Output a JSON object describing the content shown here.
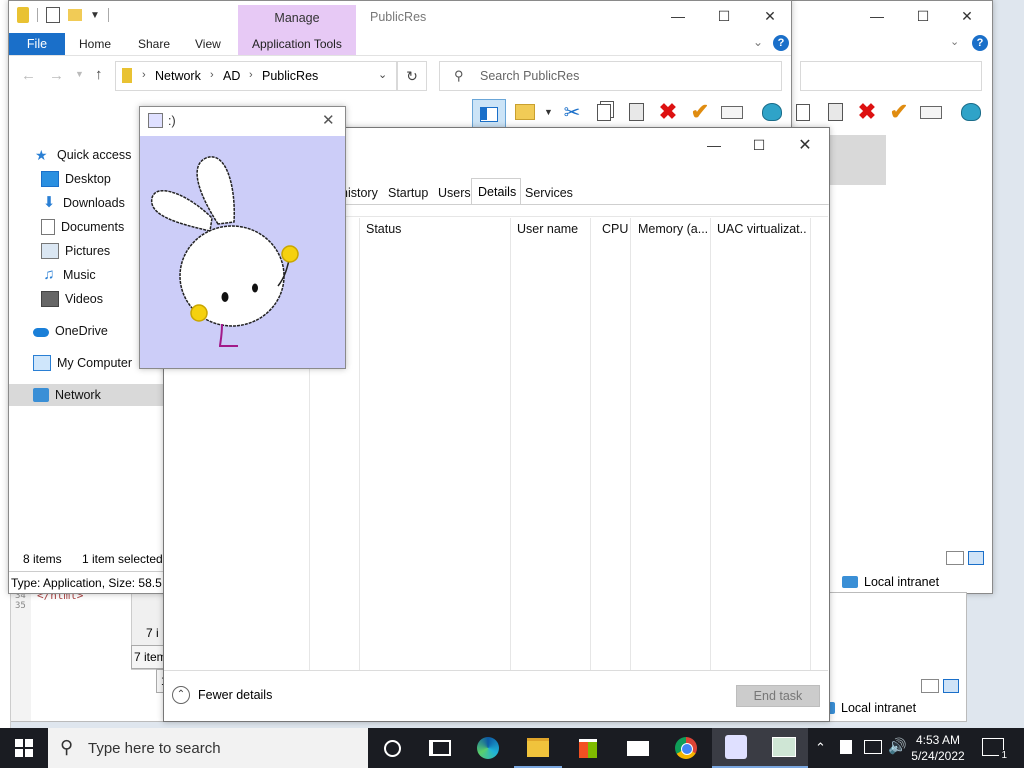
{
  "explorer_back": {
    "ribbon_tabs": [],
    "code_line_numbers": [
      "34",
      "35"
    ],
    "code_text": "</html>",
    "status_items_count": "7 items",
    "status_items_count_partial": "7 i",
    "status_partial": "1",
    "zone": "Local intranet",
    "zone2": "Local intranet"
  },
  "explorer": {
    "title": "PublicRes",
    "context_tab_group": "Manage",
    "ribbon_tabs": [
      "File",
      "Home",
      "Share",
      "View",
      "Application Tools"
    ],
    "breadcrumb": [
      "Network",
      "AD",
      "PublicRes"
    ],
    "search_placeholder": "Search PublicRes",
    "nav_items": [
      "Quick access",
      "Desktop",
      "Downloads",
      "Documents",
      "Pictures",
      "Music",
      "Videos",
      "OneDrive",
      "My Computer",
      "Network"
    ],
    "status_count": "8 items",
    "status_selected": "1 item selected",
    "details_bar": "Type: Application, Size: 58.5 M"
  },
  "bunny_window": {
    "title": ":)"
  },
  "task_manager": {
    "tabs": [
      "history",
      "Startup",
      "Users",
      "Details",
      "Services"
    ],
    "active_tab": "Details",
    "columns": [
      "Status",
      "User name",
      "CPU",
      "Memory (a...",
      "UAC virtualizat..."
    ],
    "fewer_details": "Fewer details",
    "end_task": "End task"
  },
  "taskbar": {
    "search_placeholder": "Type here to search",
    "time": "4:53 AM",
    "date": "5/24/2022",
    "notification_count": "1"
  },
  "colors": {
    "accent": "#1a6fc9",
    "manage_tab": "#e7c9f5",
    "bunny_bg": "#cccdf8",
    "taskbar": "#1a1c22"
  }
}
